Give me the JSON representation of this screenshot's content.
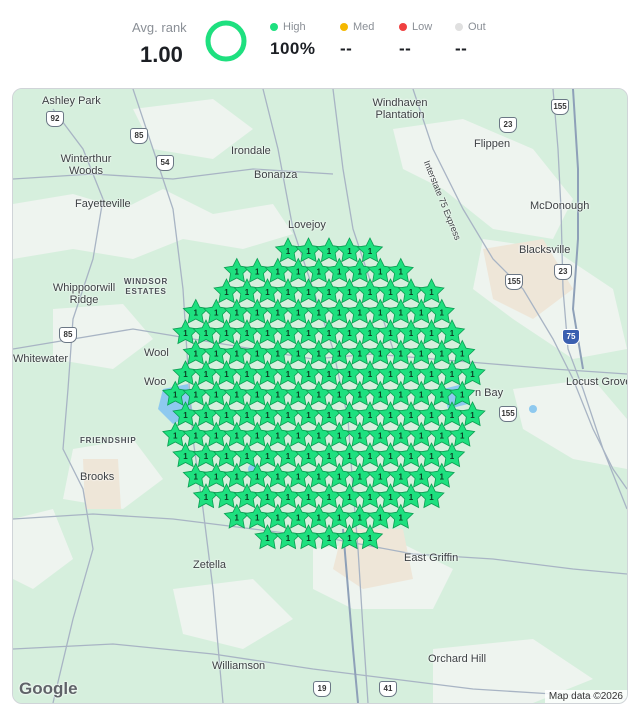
{
  "summary": {
    "avg_rank_label": "Avg. rank",
    "avg_rank_value": "1.00",
    "ring_fraction": 1.0,
    "ring_color": "#1ee07f",
    "metrics": [
      {
        "label": "High",
        "value": "100%",
        "color": "#1ee07f"
      },
      {
        "label": "Med",
        "value": "--",
        "color": "#f5b800"
      },
      {
        "label": "Low",
        "value": "--",
        "color": "#f04040"
      },
      {
        "label": "Out",
        "value": "--",
        "color": "#e0e0e0"
      }
    ]
  },
  "map": {
    "places": [
      "Ashley Park",
      "Windhaven Plantation",
      "Irondale",
      "Flippen",
      "Winterthur Woods",
      "Bonanza",
      "Fayetteville",
      "McDonough",
      "Lovejoy",
      "Blacksville",
      "Whippoorwill Ridge",
      "WINDSOR ESTATES",
      "Whitewater",
      "Locust Grove",
      "FRIENDSHIP",
      "Brooks",
      "Zetella",
      "East Griffin",
      "Williamson",
      "Orchard Hill",
      "Interstate 75 Express",
      "n Bay",
      "Wool",
      "Woo"
    ],
    "shields": [
      "92",
      "85",
      "54",
      "155",
      "23",
      "155",
      "23",
      "85",
      "75",
      "155",
      "19",
      "41"
    ],
    "marker_rank": "1",
    "marker_color": "#1ee07f",
    "marker_count": 216,
    "google_logo": "Google",
    "attribution": "Map data ©2026"
  }
}
